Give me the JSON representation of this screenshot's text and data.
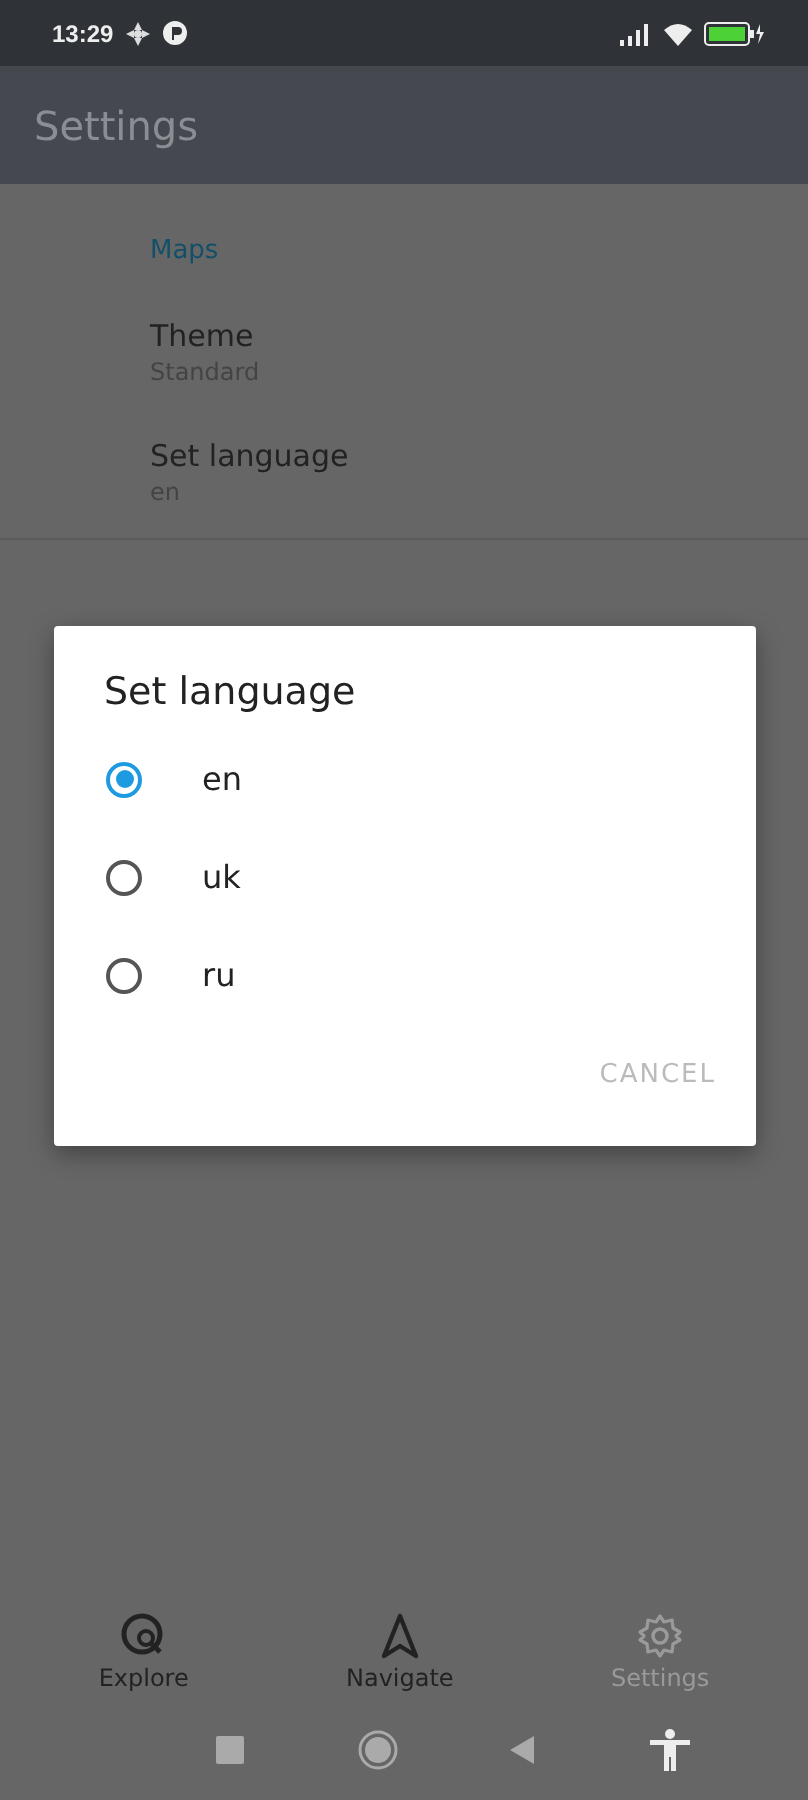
{
  "status_bar": {
    "time": "13:29"
  },
  "app_bar": {
    "title": "Settings"
  },
  "settings": {
    "section": "Maps",
    "items": [
      {
        "title": "Theme",
        "value": "Standard"
      },
      {
        "title": "Set language",
        "value": "en"
      }
    ]
  },
  "dialog": {
    "title": "Set language",
    "options": [
      {
        "label": "en",
        "selected": true
      },
      {
        "label": "uk",
        "selected": false
      },
      {
        "label": "ru",
        "selected": false
      }
    ],
    "buttons": [
      "CANCEL"
    ]
  },
  "bottom_nav": [
    {
      "kind": "explore",
      "label": "Explore",
      "selected": false
    },
    {
      "kind": "navigate",
      "label": "Navigate",
      "selected": false
    },
    {
      "kind": "settings",
      "label": "Settings",
      "selected": true
    }
  ]
}
